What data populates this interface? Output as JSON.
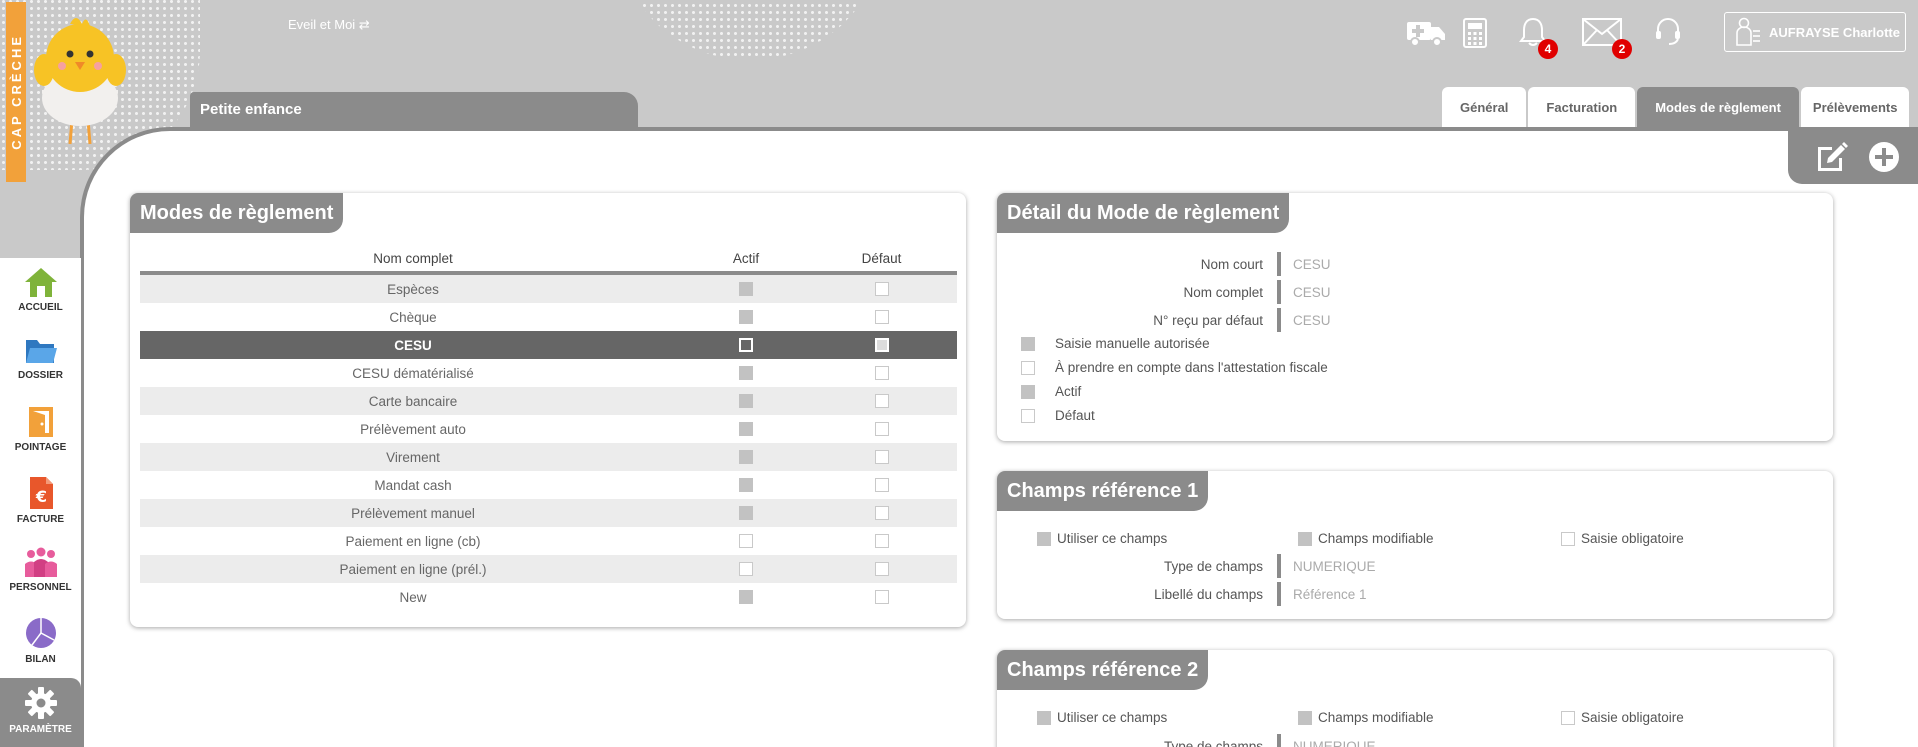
{
  "brand": {
    "name": "CAP CRÈCHE"
  },
  "header": {
    "context_switch": "Eveil et Moi",
    "notifications_count": "4",
    "messages_count": "2",
    "user_name": "AUFRAYSE Charlotte"
  },
  "section": {
    "title": "Petite enfance"
  },
  "tabs": [
    {
      "label": "Général"
    },
    {
      "label": "Facturation"
    },
    {
      "label": "Modes de règlement"
    },
    {
      "label": "Prélèvements"
    }
  ],
  "sidebar": {
    "items": [
      {
        "label": "ACCUEIL",
        "color": "#7fb33a"
      },
      {
        "label": "DOSSIER",
        "color": "#3e8fd6"
      },
      {
        "label": "POINTAGE",
        "color": "#f2a13a"
      },
      {
        "label": "FACTURE",
        "color": "#e8572b"
      },
      {
        "label": "PERSONNEL",
        "color": "#e75c9c"
      },
      {
        "label": "BILAN",
        "color": "#8a6bc8"
      },
      {
        "label": "PARAMÈTRE",
        "color": "#ffffff"
      }
    ]
  },
  "modes": {
    "title": "Modes de règlement",
    "columns": {
      "name": "Nom complet",
      "active": "Actif",
      "default": "Défaut"
    },
    "rows": [
      {
        "name": "Espèces",
        "active": true,
        "default": false
      },
      {
        "name": "Chèque",
        "active": true,
        "default": false
      },
      {
        "name": "CESU",
        "active": false,
        "default": true,
        "selected": true
      },
      {
        "name": "CESU dématérialisé",
        "active": true,
        "default": false
      },
      {
        "name": "Carte bancaire",
        "active": true,
        "default": false
      },
      {
        "name": "Prélèvement auto",
        "active": true,
        "default": false
      },
      {
        "name": "Virement",
        "active": true,
        "default": false
      },
      {
        "name": "Mandat cash",
        "active": true,
        "default": false
      },
      {
        "name": "Prélèvement manuel",
        "active": true,
        "default": false
      },
      {
        "name": "Paiement en ligne (cb)",
        "active": false,
        "default": false
      },
      {
        "name": "Paiement en ligne (prél.)",
        "active": false,
        "default": false
      },
      {
        "name": "New",
        "active": true,
        "default": false
      }
    ]
  },
  "detail": {
    "title": "Détail du Mode de règlement",
    "short_name_label": "Nom court",
    "short_name": "CESU",
    "full_name_label": "Nom complet",
    "full_name": "CESU",
    "receipt_label": "N° reçu par défaut",
    "receipt": "CESU",
    "manual_entry": "Saisie manuelle autorisée",
    "fiscal": "À prendre en compte dans l'attestation fiscale",
    "active": "Actif",
    "default": "Défaut"
  },
  "ref1": {
    "title": "Champs référence 1",
    "use": "Utiliser ce champs",
    "editable": "Champs modifiable",
    "mandatory": "Saisie obligatoire",
    "type_label": "Type de champs",
    "type": "NUMERIQUE",
    "label_label": "Libellé du champs",
    "label": "Référence 1"
  },
  "ref2": {
    "title": "Champs référence 2",
    "use": "Utiliser ce champs",
    "editable": "Champs modifiable",
    "mandatory": "Saisie obligatoire",
    "type_label": "Type de champs",
    "type": "NUMERIQUE"
  }
}
